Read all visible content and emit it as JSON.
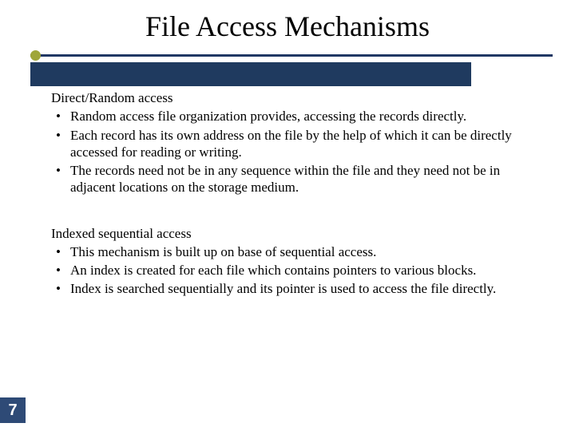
{
  "title": "File Access Mechanisms",
  "sections": [
    {
      "heading": "Direct/Random access",
      "bullets": [
        "Random access file organization provides, accessing the records directly.",
        "Each record has its own address on the file by the help of which it can be directly accessed for reading or writing.",
        "The records need not be in any sequence within the file and they need not be in adjacent locations on the storage medium."
      ]
    },
    {
      "heading": "Indexed sequential access",
      "bullets": [
        "This mechanism is built up on base of sequential access.",
        "An index is created for each file which contains pointers to various blocks.",
        "Index is searched sequentially and its pointer is used to access the file directly."
      ]
    }
  ],
  "page_number": "7"
}
